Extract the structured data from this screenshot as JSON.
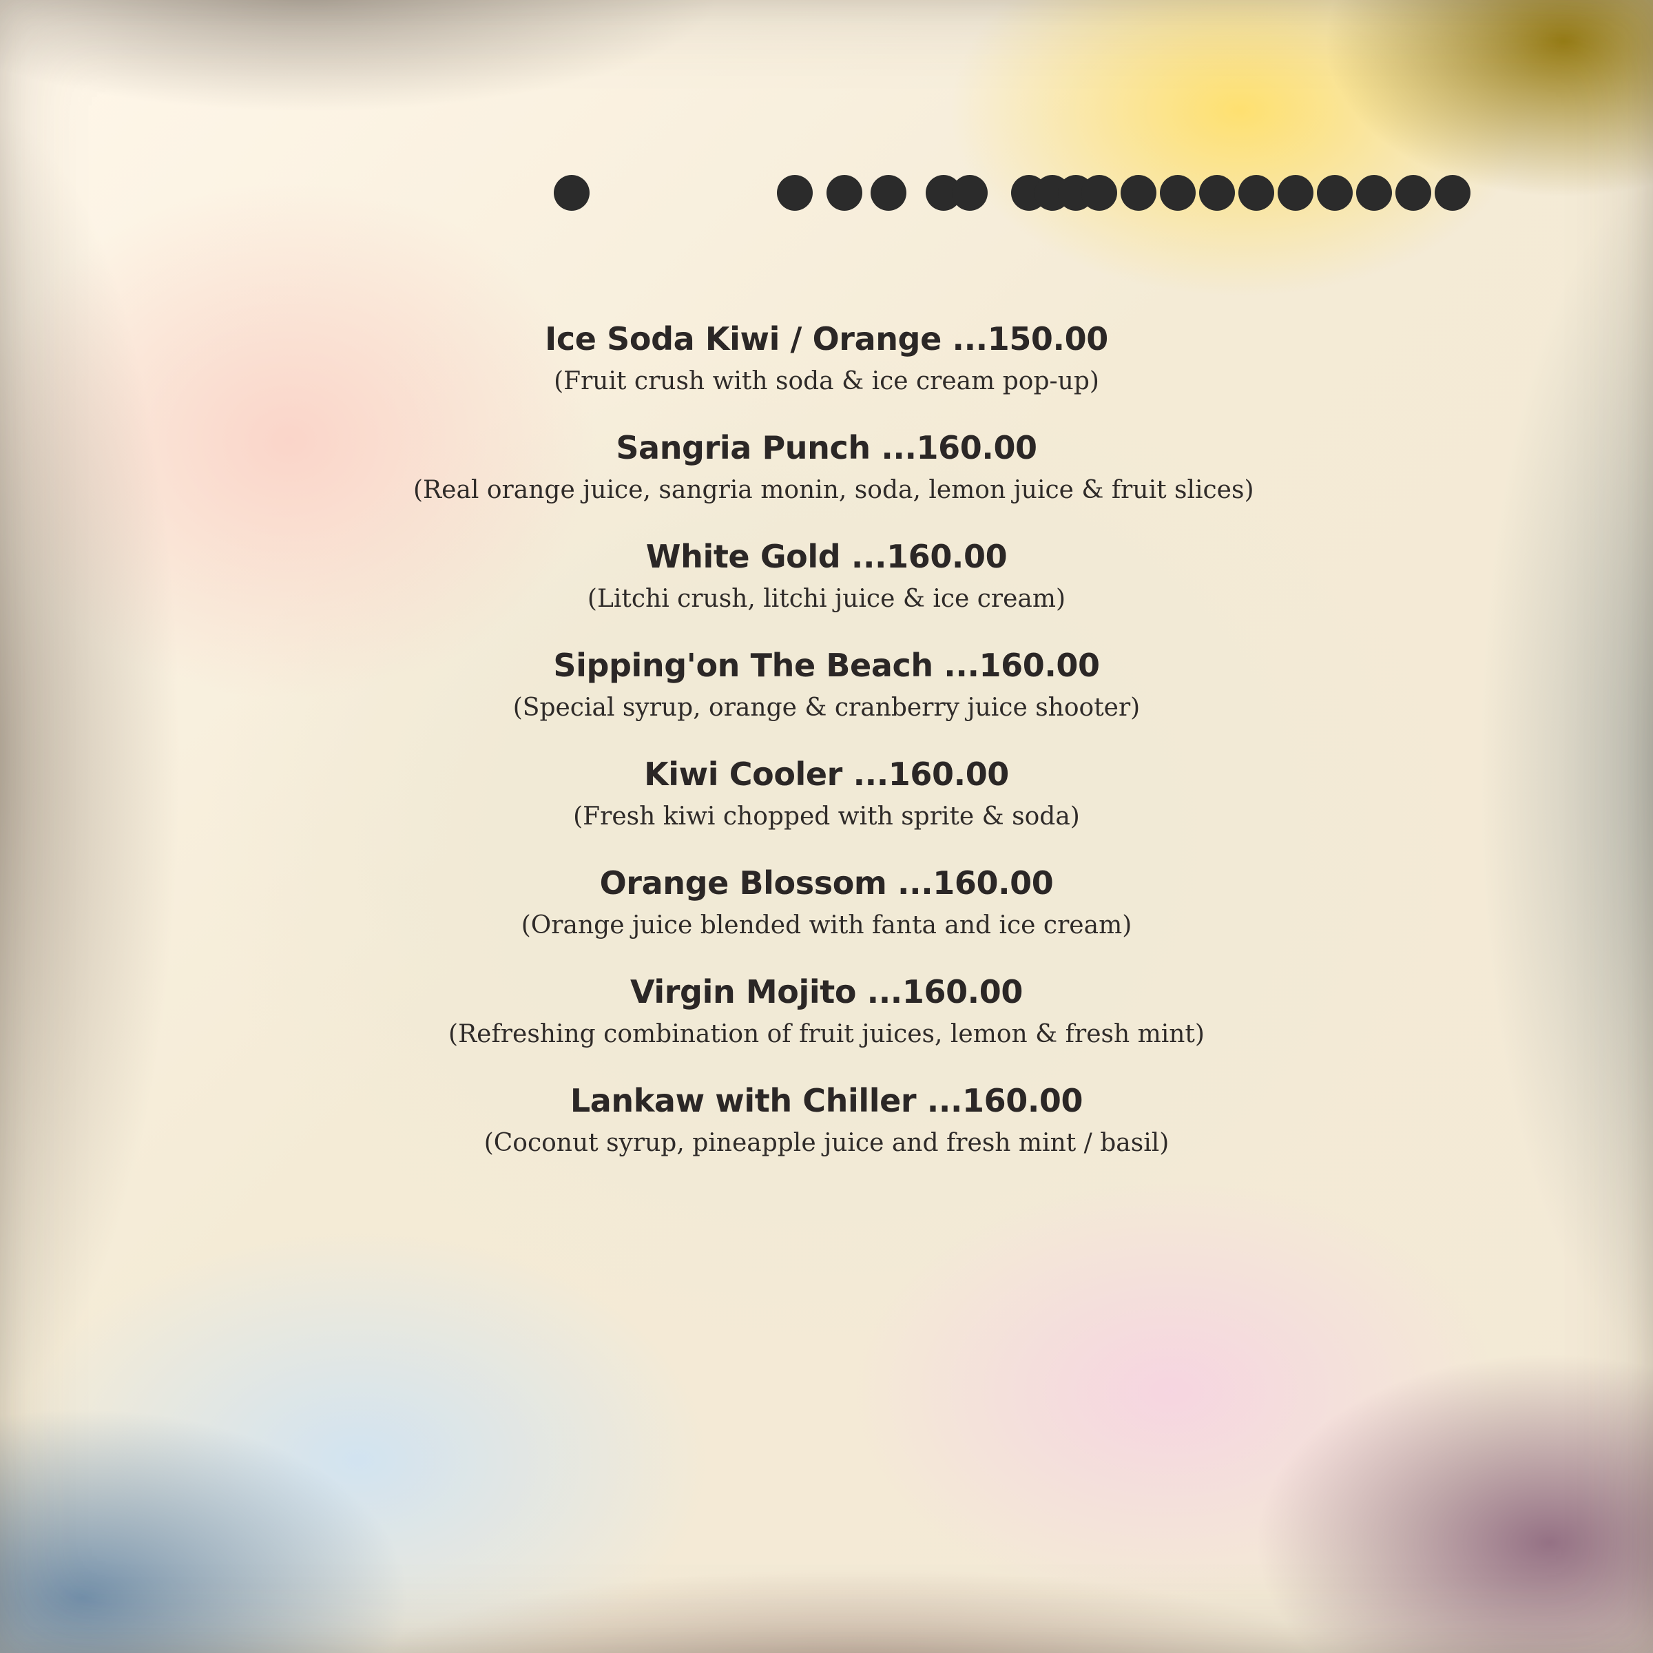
{
  "colors": {
    "text": "#2a2626",
    "dots": "#2b2b2b",
    "paper": "#f1ead6",
    "yellow_corner": "#ffe065",
    "olive_corner": "#8f7200",
    "pink_wash": "#facdc3",
    "blue_wash": "#cde2f4",
    "rose_wash": "#f6d3e2",
    "blue_corner": "#6989a8",
    "mauve_corner": "#845c76"
  },
  "decorative_dots": {
    "description": "",
    "items": [
      {
        "name": "dot-1"
      },
      {
        "name": "dot-2"
      },
      {
        "name": "dot-3"
      },
      {
        "name": "dot-4"
      },
      {
        "name": "dot-5"
      },
      {
        "name": "dot-6"
      },
      {
        "name": "dot-7"
      },
      {
        "name": "dot-8"
      },
      {
        "name": "dot-9"
      },
      {
        "name": "dot-10"
      },
      {
        "name": "dot-11"
      },
      {
        "name": "dot-12"
      },
      {
        "name": "dot-13"
      },
      {
        "name": "dot-14"
      },
      {
        "name": "dot-15"
      },
      {
        "name": "dot-16"
      },
      {
        "name": "dot-17"
      },
      {
        "name": "dot-18"
      },
      {
        "name": "dot-19"
      }
    ]
  },
  "menu": {
    "items": [
      {
        "name": "Ice Soda Kiwi / Orange ...150.00",
        "description": "(Fruit crush with soda & ice cream pop-up)"
      },
      {
        "name": "Sangria Punch ...160.00",
        "description": "(Real orange juice, sangria monin, soda, lemon juice & fruit slices)"
      },
      {
        "name": "White Gold ...160.00",
        "description": "(Litchi crush, litchi juice & ice cream)"
      },
      {
        "name": "Sipping'on The Beach ...160.00",
        "description": "(Special syrup, orange & cranberry juice shooter)"
      },
      {
        "name": "Kiwi Cooler ...160.00",
        "description": "(Fresh kiwi chopped with sprite & soda)"
      },
      {
        "name": "Orange Blossom ...160.00",
        "description": "(Orange juice blended with fanta and ice cream)"
      },
      {
        "name": "Virgin Mojito ...160.00",
        "description": "(Refreshing combination of fruit juices, lemon & fresh mint)"
      },
      {
        "name": "Lankaw with Chiller ...160.00",
        "description": "(Coconut syrup, pineapple juice and fresh mint / basil)"
      }
    ]
  }
}
